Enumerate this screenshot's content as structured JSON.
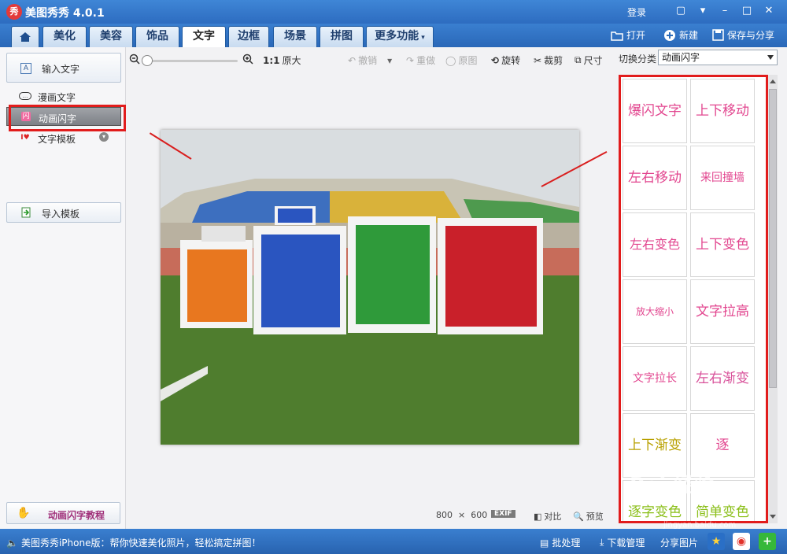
{
  "app": {
    "title": "美图秀秀 4.0.1",
    "logo_text": "秀",
    "login": "登录"
  },
  "window_controls": [
    "▢",
    "▾",
    "–",
    "□",
    "✕"
  ],
  "tabs": [
    {
      "label": "美化"
    },
    {
      "label": "美容"
    },
    {
      "label": "饰品"
    },
    {
      "label": "文字",
      "active": true
    },
    {
      "label": "边框"
    },
    {
      "label": "场景"
    },
    {
      "label": "拼图"
    },
    {
      "label": "更多功能"
    }
  ],
  "top_actions": {
    "open": "打开",
    "new": "新建",
    "save_share": "保存与分享"
  },
  "left": {
    "input_text": "输入文字",
    "comic_text": "漫画文字",
    "animated_flash": "动画闪字",
    "text_template": "文字模板",
    "import_template": "导入模板",
    "tutorial": "动画闪字教程"
  },
  "toolbar": {
    "ratio": "1:1",
    "original_size": "原大",
    "undo": "撤销",
    "redo": "重做",
    "original_image": "原图",
    "rotate": "旋转",
    "crop": "裁剪",
    "size": "尺寸"
  },
  "right": {
    "switch_label": "切换分类",
    "category": "动画闪字",
    "effects": [
      {
        "label": "爆闪文字",
        "color": "#e2468f",
        "size": 17
      },
      {
        "label": "上下移动",
        "color": "#e2468f",
        "size": 17
      },
      {
        "label": "左右移动",
        "color": "#e2468f",
        "size": 17
      },
      {
        "label": "来回撞墙",
        "color": "#e2468f",
        "size": 14
      },
      {
        "label": "左右变色",
        "color": "#e2468f",
        "size": 16
      },
      {
        "label": "上下变色",
        "color": "#e2468f",
        "size": 17
      },
      {
        "label": "放大缩小",
        "color": "#e2468f",
        "size": 12
      },
      {
        "label": "文字拉高",
        "color": "#e2468f",
        "size": 17
      },
      {
        "label": "文字拉长",
        "color": "#e2468f",
        "size": 14
      },
      {
        "label": "左右渐变",
        "color": "#d8519a",
        "size": 17
      },
      {
        "label": "上下渐变",
        "color": "#b8a000",
        "size": 17
      },
      {
        "label": "逐",
        "color": "#e2468f",
        "size": 17
      },
      {
        "label": "逐字变色",
        "color": "#8bbf1a",
        "size": 17
      },
      {
        "label": "简单变色",
        "color": "#8bbf1a",
        "size": 17
      }
    ]
  },
  "status": {
    "width": "800",
    "times": "×",
    "height": "600",
    "exif": "EXIF",
    "compare": "对比",
    "preview": "预览"
  },
  "bottom": {
    "promo": "美图秀秀iPhone版：帮你快速美化照片，轻松搞定拼图！",
    "batch": "批处理",
    "download": "下载管理",
    "share_picture": "分享图片"
  },
  "watermark": {
    "main": "Bai 经验",
    "url": "jingyan.baidu.com"
  },
  "colors": {
    "accent": "#2d6cb8",
    "highlight_red": "#e11c1c",
    "effect_pink": "#e2468f"
  }
}
